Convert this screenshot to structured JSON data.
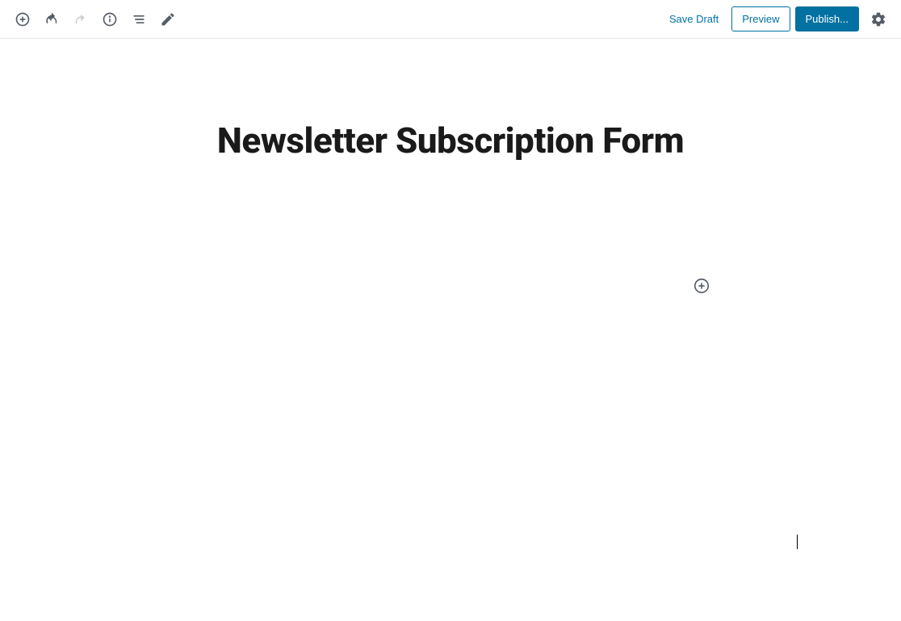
{
  "toolbar": {
    "save_draft_label": "Save Draft",
    "preview_label": "Preview",
    "publish_label": "Publish..."
  },
  "editor": {
    "post_title": "Newsletter Subscription Form"
  }
}
